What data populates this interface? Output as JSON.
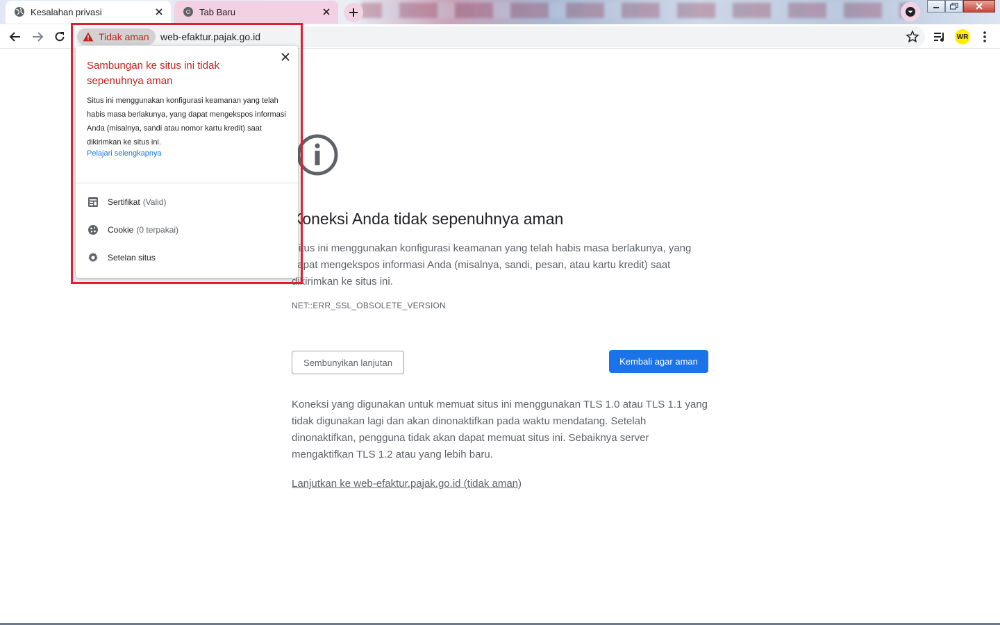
{
  "tabs": [
    {
      "title": "Kesalahan privasi",
      "active": true
    },
    {
      "title": "Tab Baru",
      "active": false
    }
  ],
  "address_bar": {
    "security_chip": "Tidak aman",
    "url": "web-efaktur.pajak.go.id"
  },
  "profile": {
    "initials": "WR"
  },
  "popup": {
    "title": "Sambungan ke situs ini tidak sepenuhnya aman",
    "body": "Situs ini menggunakan konfigurasi keamanan yang telah habis masa berlakunya, yang dapat mengekspos informasi Anda (misalnya, sandi atau nomor kartu kredit) saat dikirimkan ke situs ini.",
    "learn_more": "Pelajari selengkapnya",
    "certificate_label": "Sertifikat",
    "certificate_status": "(Valid)",
    "cookie_label": "Cookie",
    "cookie_status": "(0 terpakai)",
    "site_settings_label": "Setelan situs"
  },
  "interstitial": {
    "heading": "Koneksi Anda tidak sepenuhnya aman",
    "description": "Situs ini menggunakan konfigurasi keamanan yang telah habis masa berlakunya, yang dapat mengekspos informasi Anda (misalnya, sandi, pesan, atau kartu kredit) saat dikirimkan ke situs ini.",
    "error_code": "NET::ERR_SSL_OBSOLETE_VERSION",
    "hide_advanced_button": "Sembunyikan lanjutan",
    "back_to_safety_button": "Kembali agar aman",
    "details": "Koneksi yang digunakan untuk memuat situs ini menggunakan TLS 1.0 atau TLS 1.1 yang tidak digunakan lagi dan akan dinonaktifkan pada waktu mendatang. Setelah dinonaktifkan, pengguna tidak akan dapat memuat situs ini. Sebaiknya server mengaktifkan TLS 1.2 atau yang lebih baru.",
    "proceed_link": "Lanjutkan ke web-efaktur.pajak.go.id (tidak aman)"
  },
  "colors": {
    "warning_red": "#c5221f",
    "primary_blue": "#1a73e8",
    "highlight_box": "#e0202e",
    "inactive_tab": "#f3d0e2"
  }
}
